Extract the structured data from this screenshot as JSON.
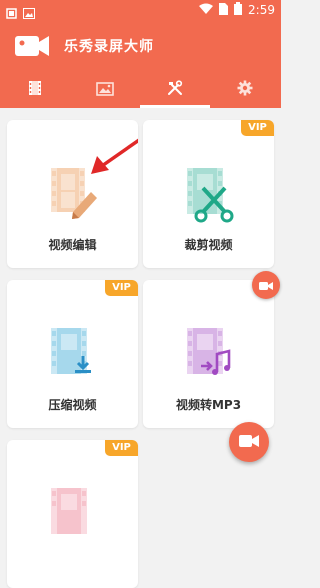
{
  "status_bar": {
    "time": "2:59",
    "icons": [
      "notification-icon",
      "image-icon",
      "wifi-icon",
      "sim-icon",
      "battery-icon"
    ]
  },
  "app_bar": {
    "title": "乐秀录屏大师",
    "logo_icon": "video-camera-icon"
  },
  "tabs": [
    {
      "icon": "film-icon",
      "active": false
    },
    {
      "icon": "image-icon",
      "active": false
    },
    {
      "icon": "tools-icon",
      "active": true
    },
    {
      "icon": "gear-icon",
      "active": false
    }
  ],
  "cards": [
    {
      "label": "视频编辑",
      "vip": false,
      "icon": "video-edit-icon"
    },
    {
      "label": "裁剪视频",
      "vip": true,
      "vip_label": "VIP",
      "icon": "video-cut-icon"
    },
    {
      "label": "压缩视频",
      "vip": true,
      "vip_label": "VIP",
      "icon": "video-compress-icon"
    },
    {
      "label": "视频转MP3",
      "vip": false,
      "icon": "video-to-mp3-icon"
    },
    {
      "label": "",
      "vip": true,
      "vip_label": "VIP",
      "icon": "video-icon"
    }
  ],
  "colors": {
    "brand": "#f26a4f",
    "vip": "#f7a62a",
    "background": "#f2f2f2"
  }
}
